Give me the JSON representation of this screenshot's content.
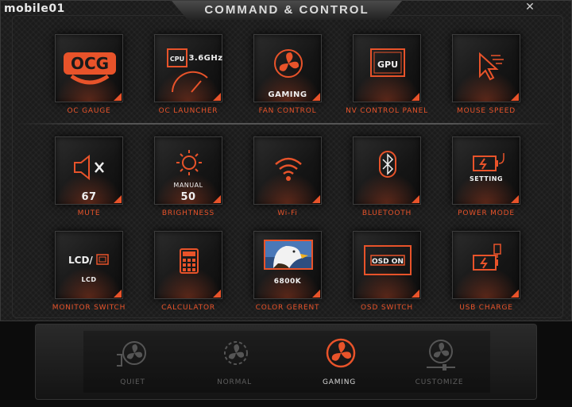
{
  "watermark": "mobile01",
  "window": {
    "title": "COMMAND & CONTROL",
    "close_glyph": "✕"
  },
  "tiles": [
    {
      "label": "OC GAUGE",
      "icon": "oc-gauge-icon",
      "sub": ""
    },
    {
      "label": "OC LAUNCHER",
      "icon": "cpu-gauge-icon",
      "sub": "3.6GHz",
      "chip": "CPU"
    },
    {
      "label": "FAN CONTROL",
      "icon": "fan-icon",
      "sub": "GAMING"
    },
    {
      "label": "NV CONTROL PANEL",
      "icon": "gpu-icon",
      "sub": "",
      "chip": "GPU"
    },
    {
      "label": "MOUSE SPEED",
      "icon": "mouse-cursor-icon",
      "sub": ""
    },
    {
      "label": "MUTE",
      "icon": "speaker-mute-icon",
      "sub": "67"
    },
    {
      "label": "BRIGHTNESS",
      "icon": "sun-icon",
      "sub": "50",
      "sub2": "MANUAL"
    },
    {
      "label": "Wi-Fi",
      "icon": "wifi-icon",
      "sub": ""
    },
    {
      "label": "BLUETOOTH",
      "icon": "bluetooth-icon",
      "sub": ""
    },
    {
      "label": "POWER MODE",
      "icon": "battery-plug-icon",
      "sub": "SETTING"
    },
    {
      "label": "MONITOR SWITCH",
      "icon": "monitor-switch-icon",
      "sub": "LCD",
      "chip": "LCD/"
    },
    {
      "label": "CALCULATOR",
      "icon": "calculator-icon",
      "sub": ""
    },
    {
      "label": "COLOR GERENT",
      "icon": "eagle-photo-icon",
      "sub": "6800K"
    },
    {
      "label": "OSD SWITCH",
      "icon": "osd-icon",
      "sub": "",
      "chip": "OSD ON"
    },
    {
      "label": "USB CHARGE",
      "icon": "usb-battery-icon",
      "sub": ""
    }
  ],
  "modes": [
    {
      "label": "QUIET",
      "active": false
    },
    {
      "label": "NORMAL",
      "active": false
    },
    {
      "label": "GAMING",
      "active": true
    },
    {
      "label": "CUSTOMIZE",
      "active": false
    }
  ],
  "colors": {
    "accent": "#e8532a",
    "text": "#efefef",
    "inactive": "#5e5e5e"
  }
}
